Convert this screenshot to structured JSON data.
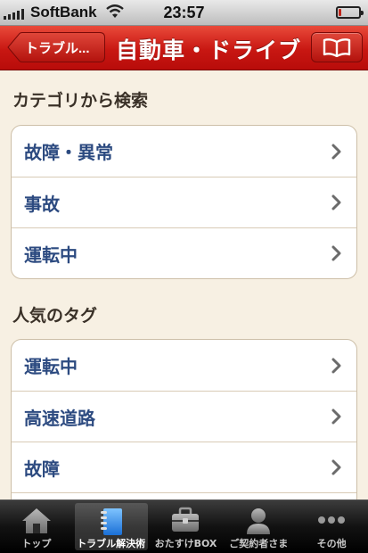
{
  "status_bar": {
    "carrier": "SoftBank",
    "time": "23:57",
    "battery_level": 0.15
  },
  "nav": {
    "back_label": "トラブル...",
    "title": "自動車・ドライブ",
    "book_icon": "book-icon"
  },
  "sections": [
    {
      "header": "カテゴリから検索",
      "items": [
        {
          "label": "故障・異常"
        },
        {
          "label": "事故"
        },
        {
          "label": "運転中"
        }
      ]
    },
    {
      "header": "人気のタグ",
      "items": [
        {
          "label": "運転中"
        },
        {
          "label": "高速道路"
        },
        {
          "label": "故障"
        }
      ]
    }
  ],
  "tab_bar": {
    "tabs": [
      {
        "label": "トップ",
        "icon": "home-icon"
      },
      {
        "label": "トラブル解決術",
        "icon": "notebook-icon",
        "active": true
      },
      {
        "label": "おたすけBOX",
        "icon": "toolbox-icon"
      },
      {
        "label": "ご契約者さま",
        "icon": "person-icon"
      },
      {
        "label": "その他",
        "icon": "more-icon"
      }
    ]
  },
  "colors": {
    "nav_red": "#c81712",
    "row_text": "#2c4a80",
    "background": "#f7f0e3"
  }
}
